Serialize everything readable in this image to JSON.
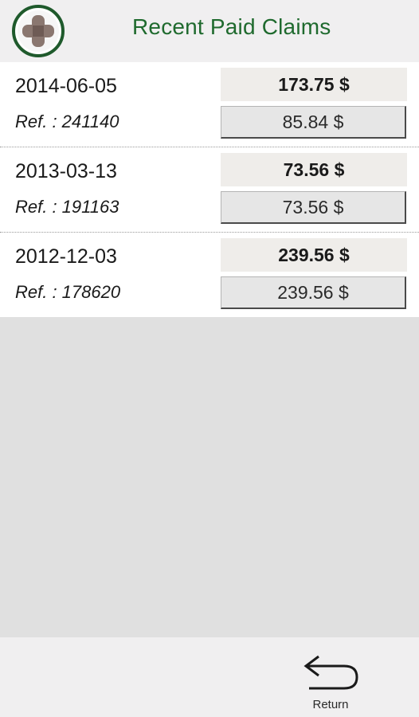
{
  "header": {
    "title": "Recent Paid Claims",
    "logo_icon": "green-cross-logo-icon"
  },
  "claims": [
    {
      "date": "2014-06-05",
      "ref": "Ref. : 241140",
      "total": "173.75 $",
      "paid": "85.84 $"
    },
    {
      "date": "2013-03-13",
      "ref": "Ref. : 191163",
      "total": "73.56 $",
      "paid": "73.56 $"
    },
    {
      "date": "2012-12-03",
      "ref": "Ref. : 178620",
      "total": "239.56 $",
      "paid": "239.56 $"
    }
  ],
  "footer": {
    "return_label": "Return",
    "return_icon": "return-arrow-icon"
  },
  "colors": {
    "brand_green": "#1f6a2e",
    "header_bg": "#f0eff0",
    "empty_bg": "#e0e0e0"
  }
}
